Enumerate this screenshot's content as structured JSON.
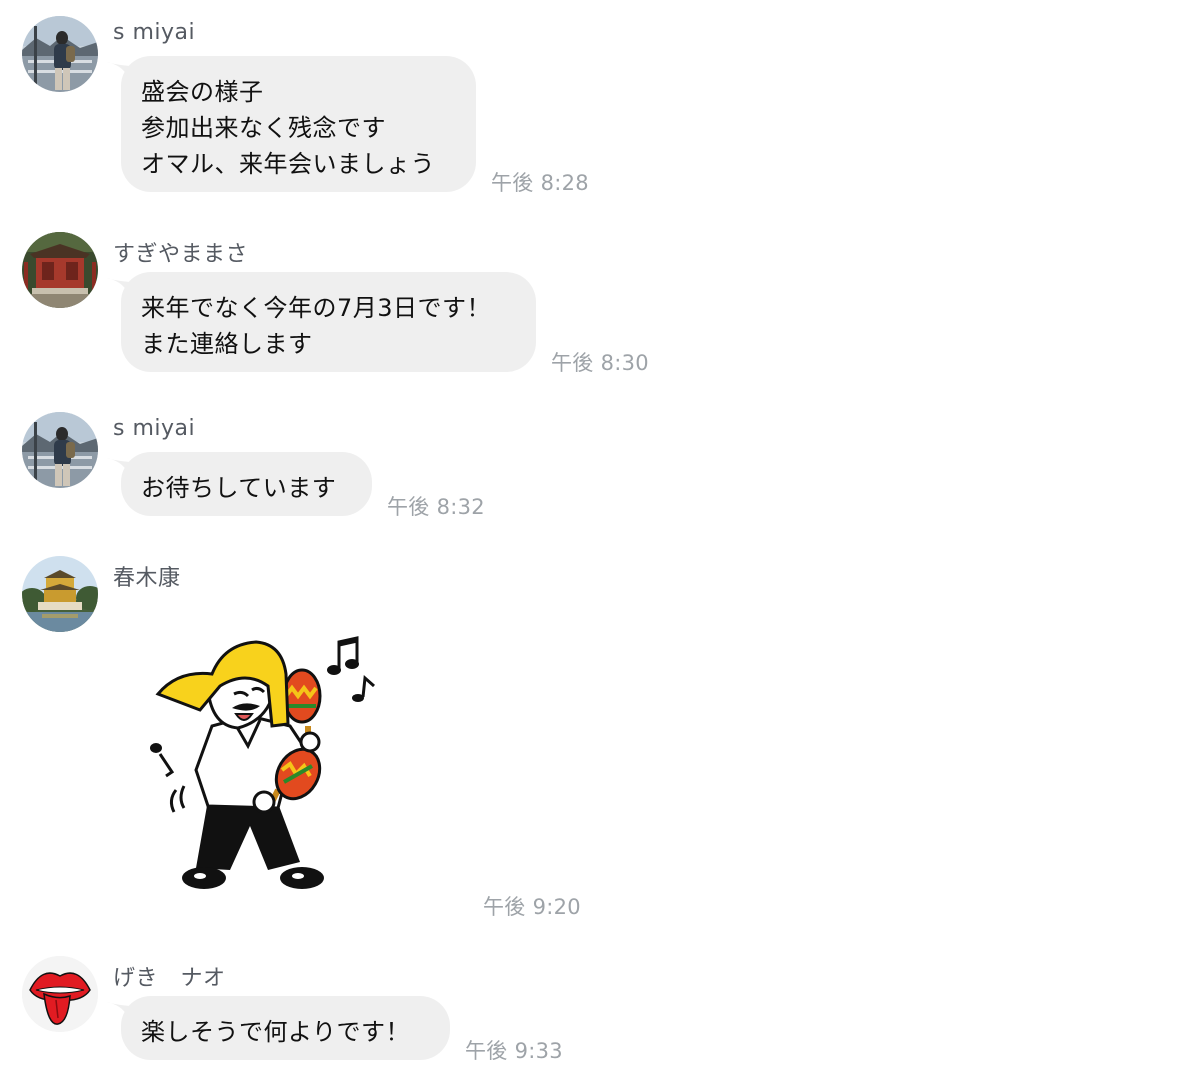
{
  "messages": [
    {
      "sender": "s miyai",
      "lines": [
        "盛会の様子",
        "参加出来なく残念です",
        "オマル、来年会いましょう"
      ],
      "time": "午後 8:28"
    },
    {
      "sender": "すぎやままさ",
      "lines": [
        "来年でなく今年の7月3日です！",
        "また連絡します"
      ],
      "time": "午後 8:30"
    },
    {
      "sender": "s miyai",
      "lines": [
        "お待ちしています"
      ],
      "time": "午後 8:32"
    },
    {
      "sender": "春木康",
      "sticker": "dancing-maracas-sticker",
      "time": "午後 9:20"
    },
    {
      "sender": "げき　ナオ",
      "lines": [
        "楽しそうで何よりです！"
      ],
      "time": "午後 9:33"
    }
  ],
  "colors": {
    "bubble": "#efefef",
    "timestamp": "#9ea3a8",
    "sender": "#555a62"
  }
}
